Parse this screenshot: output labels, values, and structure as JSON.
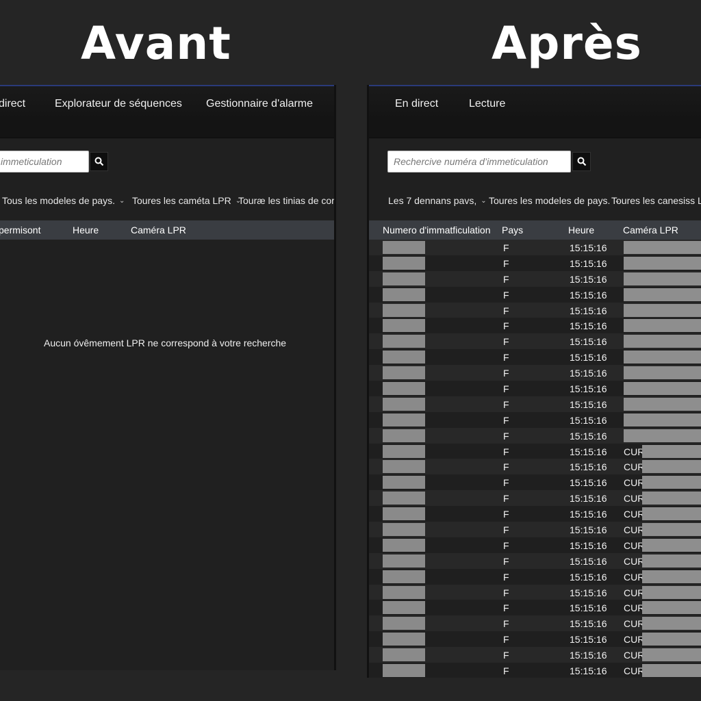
{
  "headings": {
    "before": "Avant",
    "after": "Après"
  },
  "before": {
    "nav": [
      "direct",
      "Explorateur de séquences",
      "Gestionnaire d'alarme"
    ],
    "search_placeholder": "immeticulation",
    "filters": [
      "Tous les modeles de pays.",
      "Toures les caméta LPR",
      "Touræ les tinias de corre."
    ],
    "columns": [
      "permisont",
      "Heure",
      "Caméra LPR"
    ],
    "empty_message": "Aucun óvêmement LPR ne correspond à votre recherche"
  },
  "after": {
    "nav": [
      "En direct",
      "Lecture"
    ],
    "search_placeholder": "Rechercive numéra d’immeticulation",
    "filters": [
      "Les 7 dennans pavs,",
      "Toures les modeles de pays.",
      "Toures les canesiss LPR"
    ],
    "columns": [
      "Numero d'immatficulation",
      "Pays",
      "Heure",
      "Caméra LPR"
    ],
    "rows": [
      {
        "pays": "F",
        "heure": "15:15:16",
        "camera_prefix": ""
      },
      {
        "pays": "F",
        "heure": "15:15:16",
        "camera_prefix": ""
      },
      {
        "pays": "F",
        "heure": "15:15:16",
        "camera_prefix": ""
      },
      {
        "pays": "F",
        "heure": "15:15:16",
        "camera_prefix": ""
      },
      {
        "pays": "F",
        "heure": "15:15:16",
        "camera_prefix": ""
      },
      {
        "pays": "F",
        "heure": "15:15:16",
        "camera_prefix": ""
      },
      {
        "pays": "F",
        "heure": "15:15:16",
        "camera_prefix": ""
      },
      {
        "pays": "F",
        "heure": "15:15:16",
        "camera_prefix": ""
      },
      {
        "pays": "F",
        "heure": "15:15:16",
        "camera_prefix": ""
      },
      {
        "pays": "F",
        "heure": "15:15:16",
        "camera_prefix": ""
      },
      {
        "pays": "F",
        "heure": "15:15:16",
        "camera_prefix": ""
      },
      {
        "pays": "F",
        "heure": "15:15:16",
        "camera_prefix": ""
      },
      {
        "pays": "F",
        "heure": "15:15:16",
        "camera_prefix": ""
      },
      {
        "pays": "F",
        "heure": "15:15:16",
        "camera_prefix": "CUR"
      },
      {
        "pays": "F",
        "heure": "15:15:16",
        "camera_prefix": "CUR"
      },
      {
        "pays": "F",
        "heure": "15:15:16",
        "camera_prefix": "CUR"
      },
      {
        "pays": "F",
        "heure": "15:15:16",
        "camera_prefix": "CUR"
      },
      {
        "pays": "F",
        "heure": "15:15:16",
        "camera_prefix": "CUR"
      },
      {
        "pays": "F",
        "heure": "15:15:16",
        "camera_prefix": "CUR"
      },
      {
        "pays": "F",
        "heure": "15:15:16",
        "camera_prefix": "CUR"
      },
      {
        "pays": "F",
        "heure": "15:15:16",
        "camera_prefix": "CUR"
      },
      {
        "pays": "F",
        "heure": "15:15:16",
        "camera_prefix": "CUR"
      },
      {
        "pays": "F",
        "heure": "15:15:16",
        "camera_prefix": "CUR"
      },
      {
        "pays": "F",
        "heure": "15:15:16",
        "camera_prefix": "CUR"
      },
      {
        "pays": "F",
        "heure": "15:15:16",
        "camera_prefix": "CUR"
      },
      {
        "pays": "F",
        "heure": "15:15:16",
        "camera_prefix": "CUR"
      },
      {
        "pays": "F",
        "heure": "15:15:16",
        "camera_prefix": "CUR"
      },
      {
        "pays": "F",
        "heure": "15:15:16",
        "camera_prefix": "CUR"
      }
    ]
  },
  "icons": {
    "search": "search-icon",
    "dropdown": "chevron-down-icon"
  },
  "colors": {
    "background": "#252525",
    "nav_accent": "#2d3ea0",
    "table_header": "#3a3d42",
    "redaction": "#8a8a8a"
  }
}
